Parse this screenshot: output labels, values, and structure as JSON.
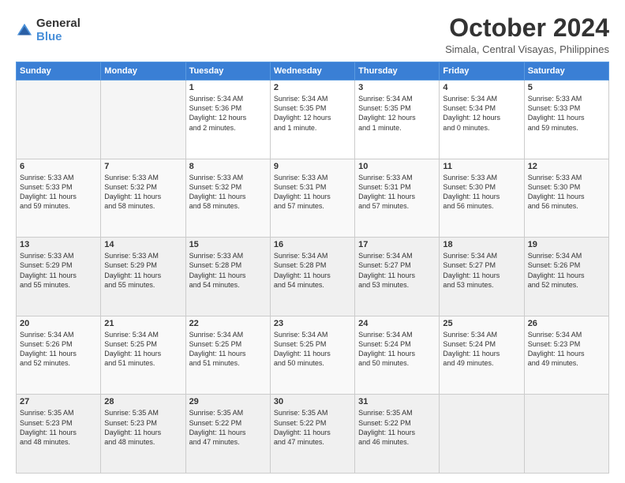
{
  "logo": {
    "general": "General",
    "blue": "Blue"
  },
  "title": "October 2024",
  "location": "Simala, Central Visayas, Philippines",
  "days": [
    "Sunday",
    "Monday",
    "Tuesday",
    "Wednesday",
    "Thursday",
    "Friday",
    "Saturday"
  ],
  "weeks": [
    [
      {
        "day": "",
        "lines": []
      },
      {
        "day": "",
        "lines": []
      },
      {
        "day": "1",
        "lines": [
          "Sunrise: 5:34 AM",
          "Sunset: 5:36 PM",
          "Daylight: 12 hours",
          "and 2 minutes."
        ]
      },
      {
        "day": "2",
        "lines": [
          "Sunrise: 5:34 AM",
          "Sunset: 5:35 PM",
          "Daylight: 12 hours",
          "and 1 minute."
        ]
      },
      {
        "day": "3",
        "lines": [
          "Sunrise: 5:34 AM",
          "Sunset: 5:35 PM",
          "Daylight: 12 hours",
          "and 1 minute."
        ]
      },
      {
        "day": "4",
        "lines": [
          "Sunrise: 5:34 AM",
          "Sunset: 5:34 PM",
          "Daylight: 12 hours",
          "and 0 minutes."
        ]
      },
      {
        "day": "5",
        "lines": [
          "Sunrise: 5:33 AM",
          "Sunset: 5:33 PM",
          "Daylight: 11 hours",
          "and 59 minutes."
        ]
      }
    ],
    [
      {
        "day": "6",
        "lines": [
          "Sunrise: 5:33 AM",
          "Sunset: 5:33 PM",
          "Daylight: 11 hours",
          "and 59 minutes."
        ]
      },
      {
        "day": "7",
        "lines": [
          "Sunrise: 5:33 AM",
          "Sunset: 5:32 PM",
          "Daylight: 11 hours",
          "and 58 minutes."
        ]
      },
      {
        "day": "8",
        "lines": [
          "Sunrise: 5:33 AM",
          "Sunset: 5:32 PM",
          "Daylight: 11 hours",
          "and 58 minutes."
        ]
      },
      {
        "day": "9",
        "lines": [
          "Sunrise: 5:33 AM",
          "Sunset: 5:31 PM",
          "Daylight: 11 hours",
          "and 57 minutes."
        ]
      },
      {
        "day": "10",
        "lines": [
          "Sunrise: 5:33 AM",
          "Sunset: 5:31 PM",
          "Daylight: 11 hours",
          "and 57 minutes."
        ]
      },
      {
        "day": "11",
        "lines": [
          "Sunrise: 5:33 AM",
          "Sunset: 5:30 PM",
          "Daylight: 11 hours",
          "and 56 minutes."
        ]
      },
      {
        "day": "12",
        "lines": [
          "Sunrise: 5:33 AM",
          "Sunset: 5:30 PM",
          "Daylight: 11 hours",
          "and 56 minutes."
        ]
      }
    ],
    [
      {
        "day": "13",
        "lines": [
          "Sunrise: 5:33 AM",
          "Sunset: 5:29 PM",
          "Daylight: 11 hours",
          "and 55 minutes."
        ]
      },
      {
        "day": "14",
        "lines": [
          "Sunrise: 5:33 AM",
          "Sunset: 5:29 PM",
          "Daylight: 11 hours",
          "and 55 minutes."
        ]
      },
      {
        "day": "15",
        "lines": [
          "Sunrise: 5:33 AM",
          "Sunset: 5:28 PM",
          "Daylight: 11 hours",
          "and 54 minutes."
        ]
      },
      {
        "day": "16",
        "lines": [
          "Sunrise: 5:34 AM",
          "Sunset: 5:28 PM",
          "Daylight: 11 hours",
          "and 54 minutes."
        ]
      },
      {
        "day": "17",
        "lines": [
          "Sunrise: 5:34 AM",
          "Sunset: 5:27 PM",
          "Daylight: 11 hours",
          "and 53 minutes."
        ]
      },
      {
        "day": "18",
        "lines": [
          "Sunrise: 5:34 AM",
          "Sunset: 5:27 PM",
          "Daylight: 11 hours",
          "and 53 minutes."
        ]
      },
      {
        "day": "19",
        "lines": [
          "Sunrise: 5:34 AM",
          "Sunset: 5:26 PM",
          "Daylight: 11 hours",
          "and 52 minutes."
        ]
      }
    ],
    [
      {
        "day": "20",
        "lines": [
          "Sunrise: 5:34 AM",
          "Sunset: 5:26 PM",
          "Daylight: 11 hours",
          "and 52 minutes."
        ]
      },
      {
        "day": "21",
        "lines": [
          "Sunrise: 5:34 AM",
          "Sunset: 5:25 PM",
          "Daylight: 11 hours",
          "and 51 minutes."
        ]
      },
      {
        "day": "22",
        "lines": [
          "Sunrise: 5:34 AM",
          "Sunset: 5:25 PM",
          "Daylight: 11 hours",
          "and 51 minutes."
        ]
      },
      {
        "day": "23",
        "lines": [
          "Sunrise: 5:34 AM",
          "Sunset: 5:25 PM",
          "Daylight: 11 hours",
          "and 50 minutes."
        ]
      },
      {
        "day": "24",
        "lines": [
          "Sunrise: 5:34 AM",
          "Sunset: 5:24 PM",
          "Daylight: 11 hours",
          "and 50 minutes."
        ]
      },
      {
        "day": "25",
        "lines": [
          "Sunrise: 5:34 AM",
          "Sunset: 5:24 PM",
          "Daylight: 11 hours",
          "and 49 minutes."
        ]
      },
      {
        "day": "26",
        "lines": [
          "Sunrise: 5:34 AM",
          "Sunset: 5:23 PM",
          "Daylight: 11 hours",
          "and 49 minutes."
        ]
      }
    ],
    [
      {
        "day": "27",
        "lines": [
          "Sunrise: 5:35 AM",
          "Sunset: 5:23 PM",
          "Daylight: 11 hours",
          "and 48 minutes."
        ]
      },
      {
        "day": "28",
        "lines": [
          "Sunrise: 5:35 AM",
          "Sunset: 5:23 PM",
          "Daylight: 11 hours",
          "and 48 minutes."
        ]
      },
      {
        "day": "29",
        "lines": [
          "Sunrise: 5:35 AM",
          "Sunset: 5:22 PM",
          "Daylight: 11 hours",
          "and 47 minutes."
        ]
      },
      {
        "day": "30",
        "lines": [
          "Sunrise: 5:35 AM",
          "Sunset: 5:22 PM",
          "Daylight: 11 hours",
          "and 47 minutes."
        ]
      },
      {
        "day": "31",
        "lines": [
          "Sunrise: 5:35 AM",
          "Sunset: 5:22 PM",
          "Daylight: 11 hours",
          "and 46 minutes."
        ]
      },
      {
        "day": "",
        "lines": []
      },
      {
        "day": "",
        "lines": []
      }
    ]
  ]
}
